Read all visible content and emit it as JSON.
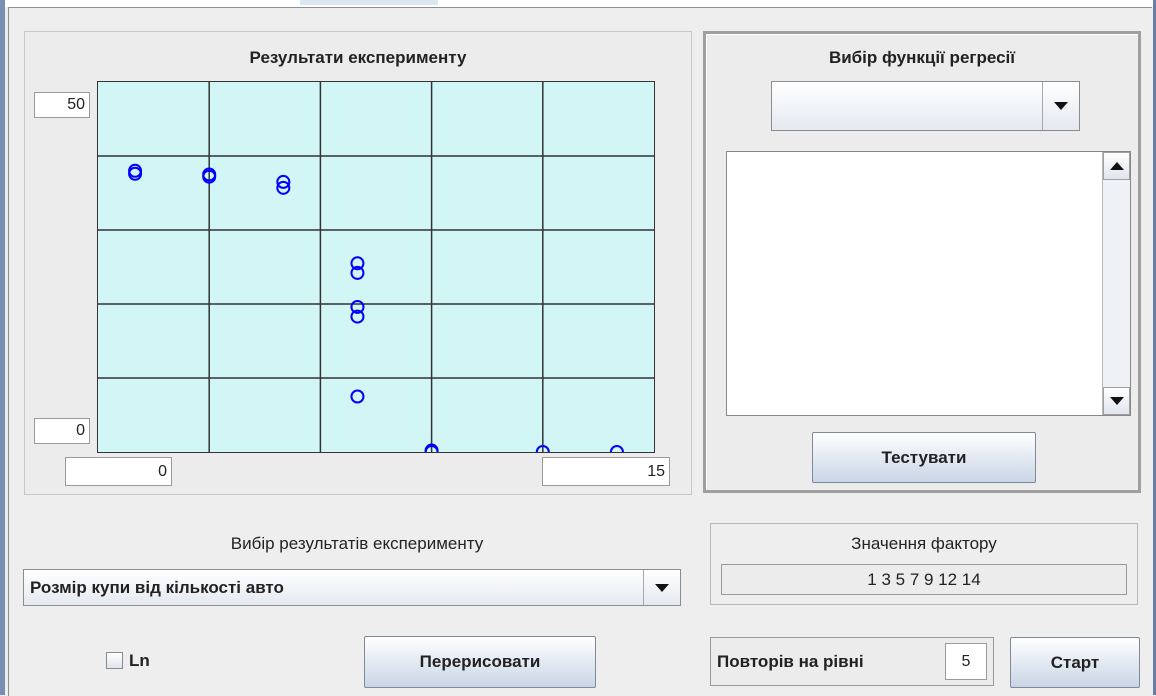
{
  "left_panel": {
    "chart_title": "Результати експерименту",
    "y_max_field": "50",
    "y_min_field": "0",
    "x_min_field": "0",
    "x_max_field": "15"
  },
  "chart_data": {
    "type": "scatter",
    "title": "Результати експерименту",
    "xlim": [
      0,
      15
    ],
    "ylim": [
      0,
      50
    ],
    "grid": true,
    "grid_cols": 5,
    "grid_rows": 5,
    "marker_color": "#0000ff",
    "background_color": "#d2f5f5",
    "points": [
      {
        "x": 1,
        "y": 38
      },
      {
        "x": 1,
        "y": 37.6
      },
      {
        "x": 3,
        "y": 37.5
      },
      {
        "x": 3,
        "y": 37.2
      },
      {
        "x": 5,
        "y": 36.5
      },
      {
        "x": 5,
        "y": 35.7
      },
      {
        "x": 7,
        "y": 25.5
      },
      {
        "x": 7,
        "y": 24.2
      },
      {
        "x": 7,
        "y": 19.6
      },
      {
        "x": 7,
        "y": 18.3
      },
      {
        "x": 7,
        "y": 7.5
      },
      {
        "x": 9,
        "y": 0
      },
      {
        "x": 9,
        "y": 0.2
      },
      {
        "x": 12,
        "y": 0
      },
      {
        "x": 14,
        "y": 0
      }
    ]
  },
  "right_panel": {
    "title": "Вибір функції регресії",
    "regression_combo_value": "",
    "test_button": "Тестувати"
  },
  "bottom": {
    "experiment_label": "Вибір результатів експерименту",
    "experiment_combo_value": "Розмір купи від кількості авто",
    "ln_checkbox_label": "Ln",
    "ln_checked": false,
    "redraw_button": "Перерисовати",
    "factor_label": "Значення фактору",
    "factor_values": "1 3 5 7 9 12 14",
    "repeats_label": "Повторів на рівні",
    "repeats_value": "5",
    "start_button": "Старт"
  }
}
